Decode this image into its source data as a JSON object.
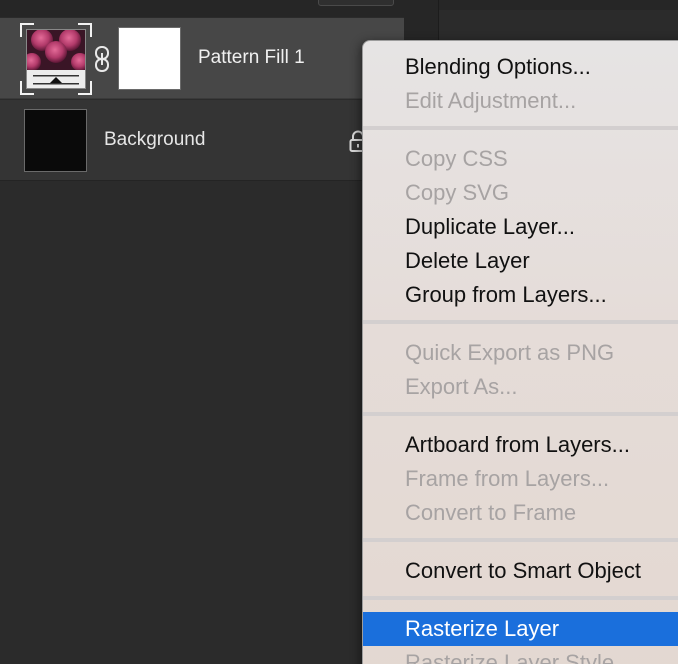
{
  "layers_panel": {
    "layers": [
      {
        "name": "Pattern Fill 1",
        "selected": true
      },
      {
        "name": "Background",
        "selected": false,
        "locked": true
      }
    ]
  },
  "context_menu": {
    "groups": [
      [
        {
          "label": "Blending Options...",
          "enabled": true
        },
        {
          "label": "Edit Adjustment...",
          "enabled": false
        }
      ],
      [
        {
          "label": "Copy CSS",
          "enabled": false
        },
        {
          "label": "Copy SVG",
          "enabled": false
        },
        {
          "label": "Duplicate Layer...",
          "enabled": true
        },
        {
          "label": "Delete Layer",
          "enabled": true
        },
        {
          "label": "Group from Layers...",
          "enabled": true
        }
      ],
      [
        {
          "label": "Quick Export as PNG",
          "enabled": false
        },
        {
          "label": "Export As...",
          "enabled": false
        }
      ],
      [
        {
          "label": "Artboard from Layers...",
          "enabled": true
        },
        {
          "label": "Frame from Layers...",
          "enabled": false
        },
        {
          "label": "Convert to Frame",
          "enabled": false
        }
      ],
      [
        {
          "label": "Convert to Smart Object",
          "enabled": true
        }
      ],
      [
        {
          "label": "Rasterize Layer",
          "enabled": true,
          "highlighted": true
        },
        {
          "label": "Rasterize Layer Style",
          "enabled": false
        }
      ]
    ]
  },
  "icons": {
    "link": "link-icon",
    "lock": "lock-icon",
    "pattern_thumbnail": "pattern-fill-thumbnail"
  },
  "colors": {
    "menu_highlight": "#1a6fdc",
    "panel_background": "#2b2b2b",
    "selected_row": "#474747"
  }
}
